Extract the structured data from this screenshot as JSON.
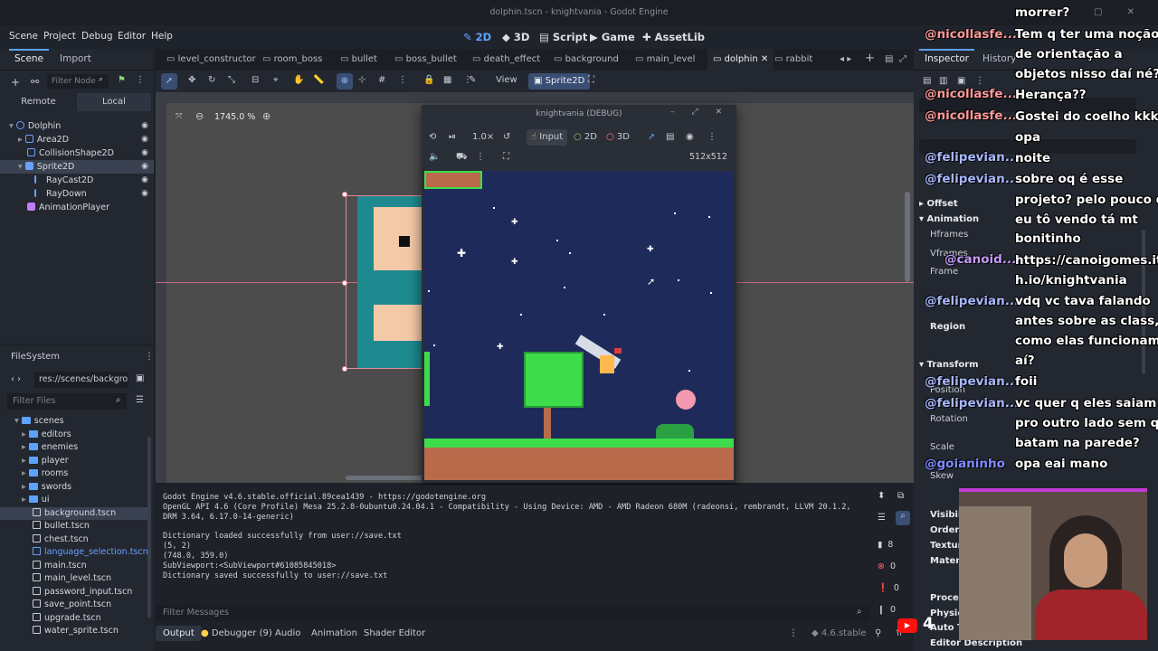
{
  "window": {
    "title": "dolphin.tscn - knightvania - Godot Engine"
  },
  "menu": [
    "Scene",
    "Project",
    "Debug",
    "Editor",
    "Help"
  ],
  "modes": [
    {
      "label": "2D",
      "active": true
    },
    {
      "label": "3D",
      "active": false
    },
    {
      "label": "Script",
      "active": false
    },
    {
      "label": "Game",
      "active": false
    },
    {
      "label": "AssetLib",
      "active": false
    }
  ],
  "scene_dock": {
    "tabs": [
      "Scene",
      "Import"
    ],
    "filter_placeholder": "Filter Node",
    "remote": "Remote",
    "local": "Local",
    "nodes": [
      "Dolphin",
      "Area2D",
      "CollisionShape2D",
      "Sprite2D",
      "RayCast2D",
      "RayDown",
      "AnimationPlayer"
    ]
  },
  "filesystem": {
    "title": "FileSystem",
    "path": "res://scenes/backgro",
    "filter_placeholder": "Filter Files",
    "items": [
      "scenes",
      "editors",
      "enemies",
      "player",
      "rooms",
      "swords",
      "ui",
      "background.tscn",
      "bullet.tscn",
      "chest.tscn",
      "language_selection.tscn",
      "main.tscn",
      "main_level.tscn",
      "password_input.tscn",
      "save_point.tscn",
      "upgrade.tscn",
      "water_sprite.tscn"
    ]
  },
  "scene_tabs": [
    "level_constructor",
    "room_boss",
    "bullet",
    "boss_bullet",
    "death_effect",
    "background",
    "main_level",
    "dolphin",
    "rabbit"
  ],
  "toolbar": {
    "view": "View",
    "sprite": "Sprite2D"
  },
  "viewport": {
    "zoom": "1745.0 %"
  },
  "game_window": {
    "title": "knightvania (DEBUG)",
    "speed": "1.0×",
    "input": "Input",
    "two_d": "2D",
    "three_d": "3D",
    "resolution": "512x512"
  },
  "output": {
    "lines": [
      "Godot Engine v4.6.stable.official.89cea1439 - https://godotengine.org",
      "OpenGL API 4.6 (Core Profile) Mesa 25.2.8-0ubuntu0.24.04.1 - Compatibility - Using Device: AMD - AMD Radeon 680M (radeonsi, rembrandt, LLVM 20.1.2,",
      "DRM 3.64, 6.17.0-14-generic)",
      "",
      "Dictionary loaded successfully from user://save.txt",
      "(5, 2)",
      "(748.0, 359.0)",
      "SubViewport:<SubViewport#61085845018>",
      "Dictionary saved successfully to user://save.txt"
    ],
    "filter_placeholder": "Filter Messages",
    "tabs": [
      "Output",
      "Debugger (9)",
      "Audio",
      "Animation",
      "Shader Editor"
    ],
    "version": "4.6.stable",
    "counts": [
      "8",
      "0",
      "0",
      "0"
    ]
  },
  "inspector": {
    "tabs": [
      "Inspector",
      "History"
    ],
    "properties": [
      "Offset",
      "Animation",
      "Hframes",
      "Vframes",
      "Frame",
      "Region",
      "Transform",
      "Position",
      "Rotation",
      "Scale",
      "Skew",
      "Visibility",
      "Ordering",
      "Texture",
      "Material",
      "Process",
      "Physics",
      "Auto Translate",
      "Editor Description"
    ]
  },
  "chat": [
    "morrer?",
    "Tem q ter uma noção",
    "de orientação a",
    "objetos nisso daí né?",
    "Herança??",
    "Gostei do coelho kkkk",
    "opa",
    "noite",
    "sobre oq é esse",
    "projeto? pelo pouco q",
    "eu tô vendo tá mt",
    "bonitinho",
    "https://canoigomes.itc",
    "h.io/knightvania",
    "vdq vc tava falando",
    "antes sobre as class,",
    "como elas funcionam",
    "aí?",
    "foii",
    "vc quer q eles saiam",
    "pro outro lado sem q",
    "batam na parede?",
    "opa eai mano"
  ],
  "chat_users": [
    "@nicollasfe...",
    "@nicollasfe...",
    "@nicollasfe...",
    "@felipevian...",
    "@felipevian...",
    "@canoid...",
    "@felipevian...",
    "@felipevian...",
    "@felipevian...",
    "@goianinho"
  ],
  "stream": {
    "badge": "4"
  },
  "colors": {
    "accent": "#5ea2ff",
    "game_bg": "#1e2a5a",
    "ground": "#3ddc4a",
    "dirt": "#b86a4a"
  }
}
